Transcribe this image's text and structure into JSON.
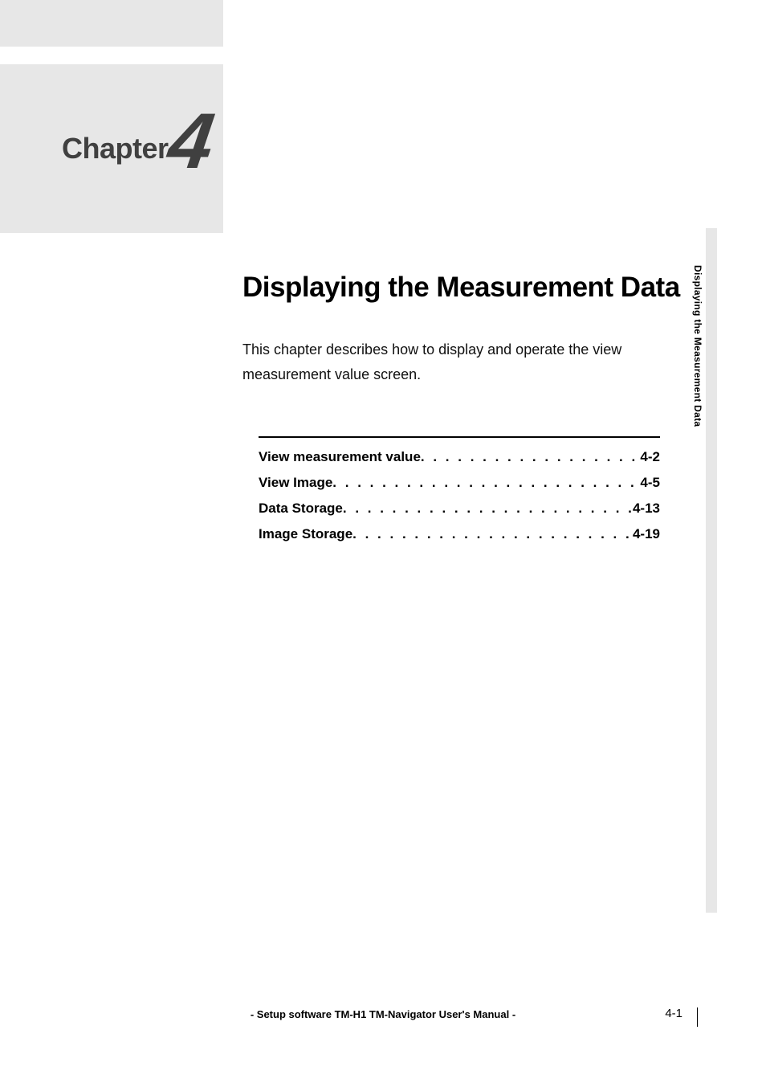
{
  "chapter": {
    "label": "Chapter",
    "number": "4",
    "title": "Displaying the Measurement Data",
    "intro": "This chapter describes how to display and operate the view measurement value screen."
  },
  "toc": [
    {
      "label": "View measurement value",
      "page": "4-2"
    },
    {
      "label": "View Image",
      "page": "4-5"
    },
    {
      "label": "Data Storage",
      "page": "4-13"
    },
    {
      "label": "Image Storage",
      "page": "4-19"
    }
  ],
  "side_tab": "Displaying the Measurement Data",
  "footer": {
    "center": "- Setup software TM-H1 TM-Navigator User's Manual -",
    "page": "4-1"
  }
}
